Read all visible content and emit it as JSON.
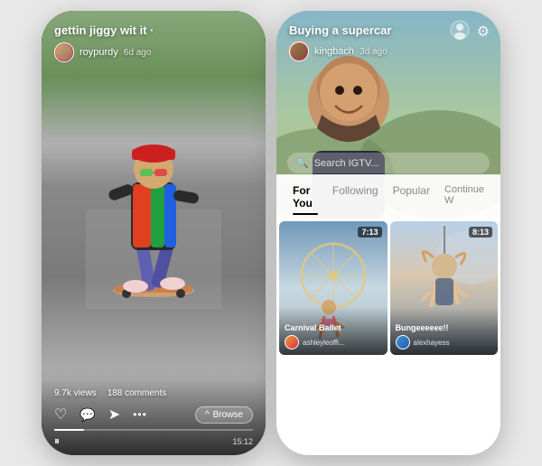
{
  "left_phone": {
    "title": "gettin jiggy wit it ·",
    "username": "roypurdy",
    "time_ago": "6d ago",
    "stats": {
      "views": "9.7k views",
      "comments": "188 comments"
    },
    "controls": {
      "browse_label": "Browse",
      "play_icon": "⏸",
      "like_icon": "♡",
      "comment_icon": "○",
      "share_icon": "➤",
      "more_icon": "···"
    },
    "duration": "15:12",
    "progress_percent": 15
  },
  "right_phone": {
    "title": "Buying a supercar",
    "username": "kingbach",
    "time_ago": "3d ago",
    "search_placeholder": "Search IGTV...",
    "tabs": [
      {
        "label": "For You",
        "active": true
      },
      {
        "label": "Following",
        "active": false
      },
      {
        "label": "Popular",
        "active": false
      },
      {
        "label": "Continue W",
        "active": false
      }
    ],
    "videos": [
      {
        "title": "Carnival Ballet",
        "username": "ashleyleoffi...",
        "duration": "7:13"
      },
      {
        "title": "Bungeeeeee!!",
        "username": "alexhayess",
        "duration": "8:13"
      }
    ]
  }
}
